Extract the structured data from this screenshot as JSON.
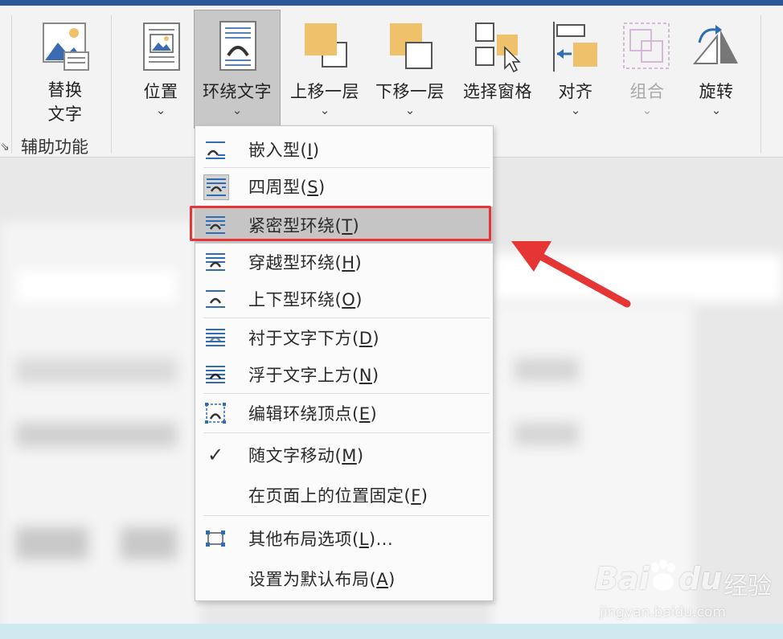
{
  "ribbon": {
    "buttons": [
      {
        "label1": "替换",
        "label2": "文字",
        "icon": "alt-text-icon"
      },
      {
        "label": "位置",
        "icon": "position-icon"
      },
      {
        "label": "环绕文字",
        "icon": "wrap-text-icon"
      },
      {
        "label": "上移一层",
        "icon": "bring-forward-icon"
      },
      {
        "label": "下移一层",
        "icon": "send-backward-icon"
      },
      {
        "label": "选择窗格",
        "icon": "selection-pane-icon"
      },
      {
        "label": "对齐",
        "icon": "align-icon"
      },
      {
        "label": "组合",
        "icon": "group-icon"
      },
      {
        "label": "旋转",
        "icon": "rotate-icon"
      }
    ],
    "group_label": "辅助功能",
    "chevron": "⌄"
  },
  "menu": {
    "items": [
      {
        "label": "嵌入型(I)",
        "text": "嵌入型(",
        "key": "I",
        "end": ")",
        "icon": "inline-wrap-icon"
      },
      {
        "label": "四周型(S)",
        "text": "四周型(",
        "key": "S",
        "end": ")",
        "icon": "square-wrap-icon"
      },
      {
        "label": "紧密型环绕(T)",
        "text": "紧密型环绕(",
        "key": "T",
        "end": ")",
        "icon": "tight-wrap-icon"
      },
      {
        "label": "穿越型环绕(H)",
        "text": "穿越型环绕(",
        "key": "H",
        "end": ")",
        "icon": "through-wrap-icon"
      },
      {
        "label": "上下型环绕(O)",
        "text": "上下型环绕(",
        "key": "O",
        "end": ")",
        "icon": "top-bottom-wrap-icon"
      },
      {
        "label": "衬于文字下方(D)",
        "text": "衬于文字下方(",
        "key": "D",
        "end": ")",
        "icon": "behind-text-icon"
      },
      {
        "label": "浮于文字上方(N)",
        "text": "浮于文字上方(",
        "key": "N",
        "end": ")",
        "icon": "in-front-text-icon"
      },
      {
        "label": "编辑环绕顶点(E)",
        "text": "编辑环绕顶点(",
        "key": "E",
        "end": ")",
        "icon": "edit-wrap-points-icon"
      },
      {
        "label": "随文字移动(M)",
        "text": "随文字移动(",
        "key": "M",
        "end": ")",
        "icon": "check-icon",
        "checked": true
      },
      {
        "label": "在页面上的位置固定(F)",
        "text": "在页面上的位置固定(",
        "key": "F",
        "end": ")",
        "icon": ""
      },
      {
        "label": "其他布局选项(L)...",
        "text": "其他布局选项(",
        "key": "L",
        "end": ")...",
        "icon": "more-layout-icon"
      },
      {
        "label": "设置为默认布局(A)",
        "text": "设置为默认布局(",
        "key": "A",
        "end": ")",
        "icon": ""
      }
    ]
  },
  "watermark": {
    "brand": "Bai",
    "brand2": "du",
    "cn": "经验",
    "url": "jingyan.baidu.com"
  },
  "colors": {
    "accent": "#2b579a",
    "highlight": "#e63535",
    "icon_blue": "#2e6db4",
    "icon_gold": "#efc16a"
  }
}
